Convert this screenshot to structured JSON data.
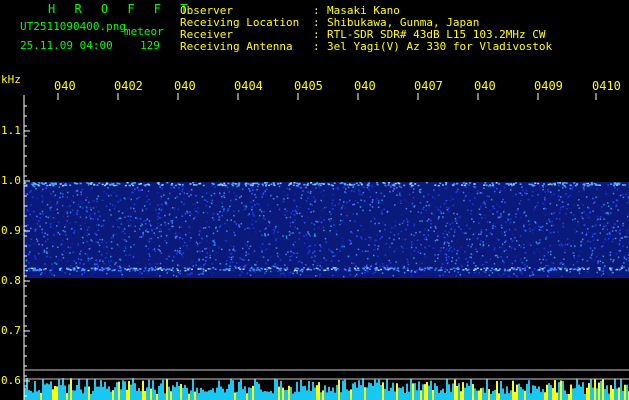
{
  "header": {
    "app_title": "H R O F F T",
    "filename": "UT2511090400.png",
    "filename_tag": "meteor",
    "datetime": "25.11.09 04:00",
    "count": "129"
  },
  "info": [
    {
      "label": "Observer",
      "value": "Masaki Kano"
    },
    {
      "label": "Receiving Location",
      "value": "Shibukawa, Gunma, Japan"
    },
    {
      "label": "Receiver",
      "value": "RTL-SDR SDR# 43dB L15 103.2MHz CW"
    },
    {
      "label": "Receiving Antenna",
      "value": "3el Yagi(V) Az 330 for Vladivostok"
    }
  ],
  "info_sep": ":",
  "axis": {
    "unit": "kHz",
    "y_ticks": [
      "1.1",
      "1.0",
      "0.9",
      "0.8",
      "0.7",
      "0.6"
    ],
    "time_ticks": [
      "040",
      "0402",
      "040",
      "0404",
      "0405",
      "040",
      "0407",
      "040",
      "0409",
      "0410"
    ]
  },
  "colors": {
    "background": "#000000",
    "header_green": "#00ff00",
    "header_yellow": "#ffff00",
    "noise_blue": "#1a2fd0",
    "bottom_cyan": "#18c8f0"
  }
}
